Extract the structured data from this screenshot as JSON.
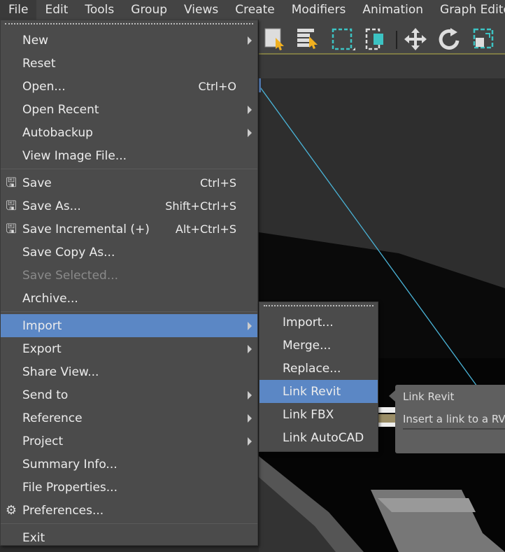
{
  "menubar": [
    "File",
    "Edit",
    "Tools",
    "Group",
    "Views",
    "Create",
    "Modifiers",
    "Animation",
    "Graph Editors"
  ],
  "file_menu": {
    "group1": [
      {
        "label": "New",
        "submenu": true
      },
      {
        "label": "Reset"
      },
      {
        "label": "Open...",
        "shortcut": "Ctrl+O"
      },
      {
        "label": "Open Recent",
        "submenu": true
      },
      {
        "label": "Autobackup",
        "submenu": true
      },
      {
        "label": "View Image File..."
      }
    ],
    "group2": [
      {
        "label": "Save",
        "shortcut": "Ctrl+S",
        "icon": "save-icon"
      },
      {
        "label": "Save As...",
        "shortcut": "Shift+Ctrl+S",
        "icon": "save-as-icon"
      },
      {
        "label": "Save Incremental (+)",
        "shortcut": "Alt+Ctrl+S",
        "icon": "save-incremental-icon"
      },
      {
        "label": "Save Copy As..."
      },
      {
        "label": "Save Selected...",
        "disabled": true
      },
      {
        "label": "Archive..."
      }
    ],
    "group3": [
      {
        "label": "Import",
        "submenu": true,
        "highlighted": true
      },
      {
        "label": "Export",
        "submenu": true
      },
      {
        "label": "Share View..."
      },
      {
        "label": "Send to",
        "submenu": true
      },
      {
        "label": "Reference",
        "submenu": true
      },
      {
        "label": "Project",
        "submenu": true
      },
      {
        "label": "Summary Info..."
      },
      {
        "label": "File Properties..."
      },
      {
        "label": "Preferences...",
        "icon": "preferences-icon"
      }
    ],
    "group4": [
      {
        "label": "Exit"
      }
    ]
  },
  "import_submenu": [
    "Import...",
    "Merge...",
    "Replace...",
    "Link Revit",
    "Link FBX",
    "Link AutoCAD"
  ],
  "tooltip": {
    "title": "Link Revit",
    "description": "Insert a link to a RVT"
  },
  "colors": {
    "highlight": "#5b87c5",
    "accent": "#3cc3c3"
  }
}
